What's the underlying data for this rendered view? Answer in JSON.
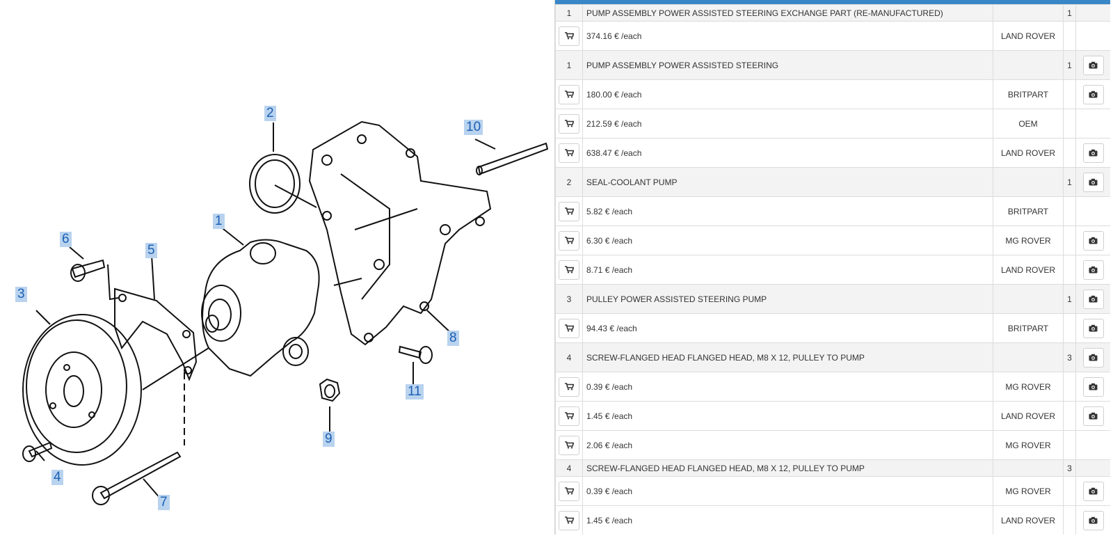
{
  "diagram": {
    "callouts": [
      "1",
      "2",
      "3",
      "4",
      "5",
      "6",
      "7",
      "8",
      "9",
      "10",
      "11"
    ]
  },
  "parts": {
    "rows": [
      {
        "type": "head",
        "ref": "1",
        "desc": "PUMP ASSEMBLY POWER ASSISTED STEERING EXCHANGE PART (RE-MANUFACTURED)",
        "qty": "1",
        "photo": false
      },
      {
        "type": "price",
        "price": "374.16 € /each",
        "brand": "LAND ROVER",
        "photo": false
      },
      {
        "type": "head",
        "ref": "1",
        "desc": "PUMP ASSEMBLY POWER ASSISTED STEERING",
        "qty": "1",
        "photo": true
      },
      {
        "type": "price",
        "price": "180.00 € /each",
        "brand": "BRITPART",
        "photo": true
      },
      {
        "type": "price",
        "price": "212.59 € /each",
        "brand": "OEM",
        "photo": false
      },
      {
        "type": "price",
        "price": "638.47 € /each",
        "brand": "LAND ROVER",
        "photo": true
      },
      {
        "type": "head",
        "ref": "2",
        "desc": "SEAL-COOLANT PUMP",
        "qty": "1",
        "photo": true
      },
      {
        "type": "price",
        "price": "5.82 € /each",
        "brand": "BRITPART",
        "photo": false
      },
      {
        "type": "price",
        "price": "6.30 € /each",
        "brand": "MG ROVER",
        "photo": true
      },
      {
        "type": "price",
        "price": "8.71 € /each",
        "brand": "LAND ROVER",
        "photo": true
      },
      {
        "type": "head",
        "ref": "3",
        "desc": "PULLEY POWER ASSISTED STEERING PUMP",
        "qty": "1",
        "photo": true
      },
      {
        "type": "price",
        "price": "94.43 € /each",
        "brand": "BRITPART",
        "photo": true
      },
      {
        "type": "head",
        "ref": "4",
        "desc": "SCREW-FLANGED HEAD FLANGED HEAD, M8 X 12, PULLEY TO PUMP",
        "qty": "3",
        "photo": true
      },
      {
        "type": "price",
        "price": "0.39 € /each",
        "brand": "MG ROVER",
        "photo": true
      },
      {
        "type": "price",
        "price": "1.45 € /each",
        "brand": "LAND ROVER",
        "photo": true
      },
      {
        "type": "price",
        "price": "2.06 € /each",
        "brand": "MG ROVER",
        "photo": false
      },
      {
        "type": "head",
        "ref": "4",
        "desc": "SCREW-FLANGED HEAD FLANGED HEAD, M8 X 12, PULLEY TO PUMP",
        "qty": "3",
        "photo": false
      },
      {
        "type": "price",
        "price": "0.39 € /each",
        "brand": "MG ROVER",
        "photo": true
      },
      {
        "type": "price",
        "price": "1.45 € /each",
        "brand": "LAND ROVER",
        "photo": true
      }
    ]
  }
}
